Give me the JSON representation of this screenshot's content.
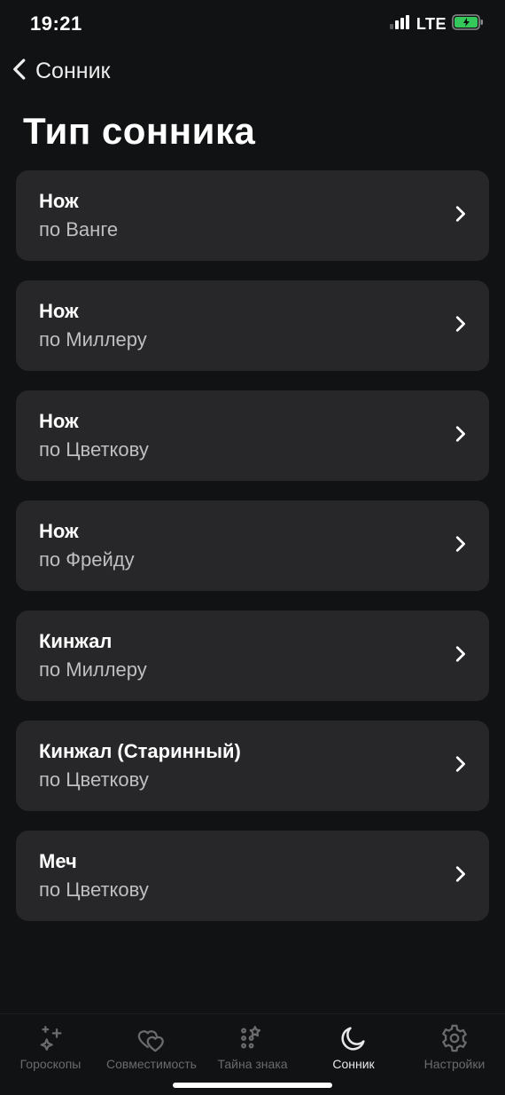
{
  "status": {
    "time": "19:21",
    "network": "LTE"
  },
  "nav": {
    "back_label": "Сонник"
  },
  "page": {
    "title": "Тип сонника"
  },
  "items": [
    {
      "title": "Нож",
      "subtitle": "по Ванге"
    },
    {
      "title": "Нож",
      "subtitle": "по Миллеру"
    },
    {
      "title": "Нож",
      "subtitle": "по Цветкову"
    },
    {
      "title": "Нож",
      "subtitle": "по Фрейду"
    },
    {
      "title": "Кинжал",
      "subtitle": "по Миллеру"
    },
    {
      "title": "Кинжал (Старинный)",
      "subtitle": "по Цветкову"
    },
    {
      "title": "Меч",
      "subtitle": "по Цветкову"
    }
  ],
  "tabs": [
    {
      "label": "Гороскопы",
      "active": false
    },
    {
      "label": "Совместимость",
      "active": false
    },
    {
      "label": "Тайна знака",
      "active": false
    },
    {
      "label": "Сонник",
      "active": true
    },
    {
      "label": "Настройки",
      "active": false
    }
  ]
}
